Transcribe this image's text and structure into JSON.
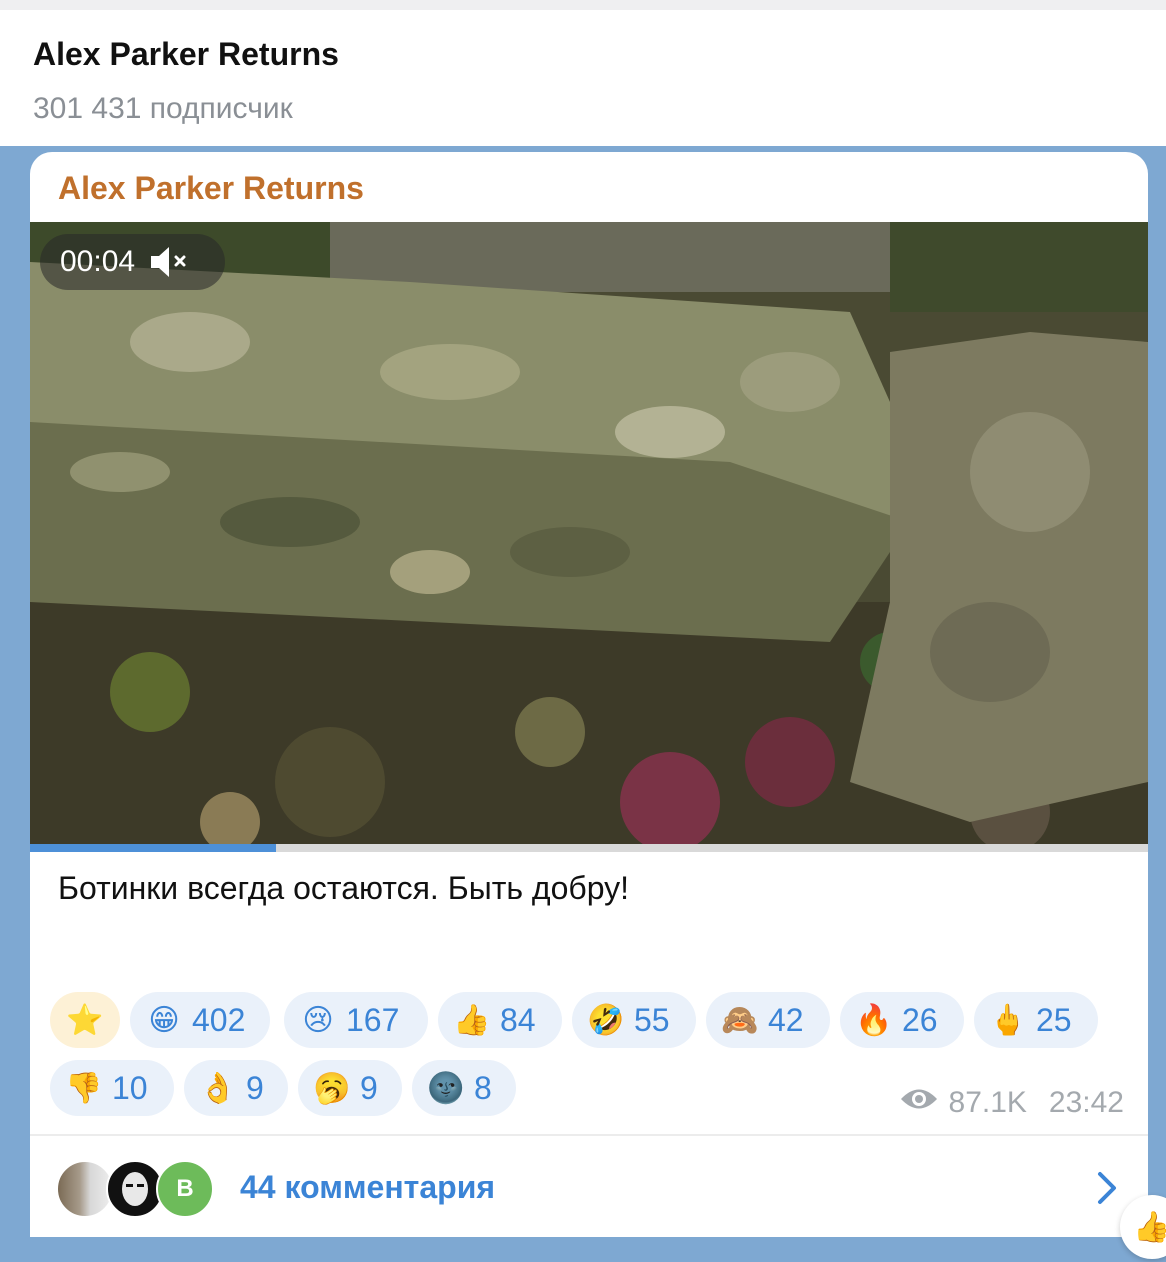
{
  "header": {
    "title": "Alex Parker Returns",
    "subscribers": "301 431 подписчик"
  },
  "message": {
    "author": "Alex Parker Returns",
    "video": {
      "time": "00:04",
      "mute_icon": "muted-speaker-icon",
      "progress": 0.22
    },
    "caption": "Ботинки всегда остаются. Быть добру!",
    "reactions": [
      {
        "emoji": "⭐",
        "count": ""
      },
      {
        "emoji": "😁",
        "count": "402"
      },
      {
        "emoji": "😢",
        "count": "167"
      },
      {
        "emoji": "👍",
        "count": "84"
      },
      {
        "emoji": "🤣",
        "count": "55"
      },
      {
        "emoji": "🙈",
        "count": "42"
      },
      {
        "emoji": "🔥",
        "count": "26"
      },
      {
        "emoji": "🖕",
        "count": "25"
      },
      {
        "emoji": "👎",
        "count": "10"
      },
      {
        "emoji": "👌",
        "count": "9"
      },
      {
        "emoji": "🥱",
        "count": "9"
      },
      {
        "emoji": "🌚",
        "count": "8"
      }
    ],
    "views": "87.1K",
    "time": "23:42",
    "comments": {
      "label": "44 комментария",
      "avatar_letter": "B"
    }
  },
  "float_button": {
    "emoji": "👍"
  },
  "colors": {
    "author": "#c0702c",
    "link": "#3b84d6",
    "reaction_bg": "#eaf1fa",
    "chat_bg": "#7ea8d2"
  }
}
